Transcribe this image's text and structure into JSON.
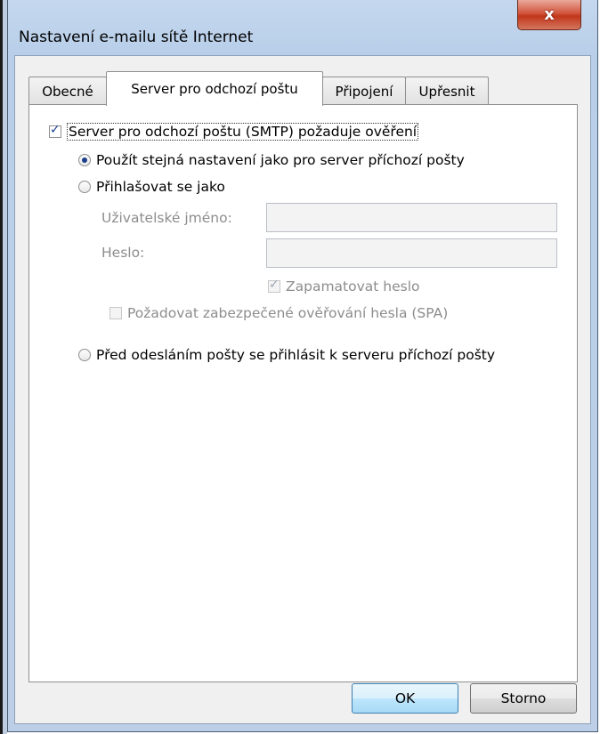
{
  "window": {
    "title": "Nastavení e-mailu sítě Internet"
  },
  "tabs": [
    {
      "label": "Obecné",
      "active": false
    },
    {
      "label": "Server pro odchozí poštu",
      "active": true
    },
    {
      "label": "Připojení",
      "active": false
    },
    {
      "label": "Upřesnit",
      "active": false
    }
  ],
  "smtp_auth": {
    "label": "Server pro odchozí poštu (SMTP) požaduje ověření",
    "checked": true
  },
  "options": {
    "use_same": {
      "label": "Použít stejná nastavení jako pro server příchozí pošty",
      "selected": true
    },
    "login_as": {
      "label": "Přihlašovat se jako",
      "selected": false
    },
    "username_label": "Uživatelské jméno:",
    "username_value": "",
    "password_label": "Heslo:",
    "password_value": "",
    "remember_password": {
      "label": "Zapamatovat heslo",
      "checked": true,
      "enabled": false
    },
    "spa": {
      "label": "Požadovat zabezpečené ověřování hesla (SPA)",
      "checked": false,
      "enabled": false
    },
    "login_before_send": {
      "label": "Před odesláním pošty se přihlásit k serveru příchozí pošty",
      "selected": false
    }
  },
  "buttons": {
    "ok": "OK",
    "cancel": "Storno",
    "close_glyph": "x"
  }
}
